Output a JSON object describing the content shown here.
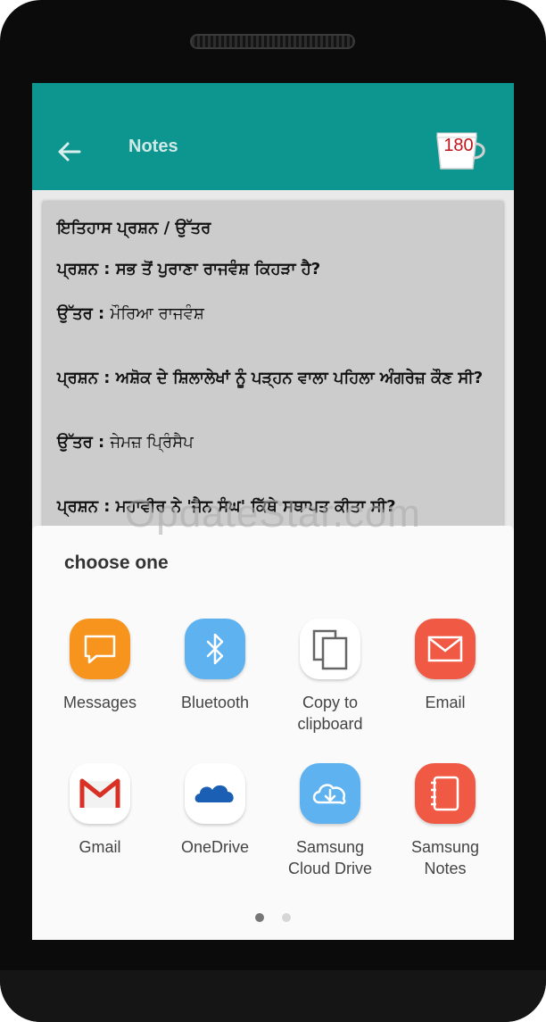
{
  "appbar": {
    "title": "Notes",
    "counter": "180",
    "colors": {
      "bar": "#0d9690",
      "counter": "#c0141c"
    }
  },
  "note": {
    "heading": "ਇਤਿਹਾਸ ਪ੍ਰਸ਼ਨ / ਉੱਤਰ",
    "qa": [
      {
        "q_label": "ਪ੍ਰਸ਼ਨ",
        "q": "ਸਭ ਤੋਂ ਪੁਰਾਣਾ ਰਾਜਵੰਸ਼ ਕਿਹੜਾ ਹੈ?",
        "a_label": "ਉੱਤਰ",
        "a": "ਮੌਰਿਆ ਰਾਜਵੰਸ਼"
      },
      {
        "q_label": "ਪ੍ਰਸ਼ਨ",
        "q": "ਅਸ਼ੋਕ ਦੇ ਸ਼ਿਲਾਲੇਖਾਂ ਨੂੰ ਪੜ੍ਹਨ ਵਾਲਾ ਪਹਿਲਾ ਅੰਗਰੇਜ਼ ਕੌਣ ਸੀ?",
        "a_label": "ਉੱਤਰ",
        "a": "ਜੇਮਜ਼ ਪ੍ਰਿੰਸੈਪ"
      },
      {
        "q_label": "ਪ੍ਰਸ਼ਨ",
        "q": "ਮਹਾਵੀਰ ਨੇ 'ਜੈਨ ਸੰਘ' ਕਿੱਥੇ ਸਥਾਪਤ ਕੀਤਾ ਸੀ?"
      }
    ]
  },
  "watermark": "OpdateStar.com",
  "share_sheet": {
    "title": "choose one",
    "apps": [
      {
        "label": "Messages",
        "icon": "messages-icon",
        "color": "#f7941d"
      },
      {
        "label": "Bluetooth",
        "icon": "bluetooth-icon",
        "color": "#5fb2f0"
      },
      {
        "label": "Copy to\nclipboard",
        "icon": "copy-icon",
        "color": "#ffffff"
      },
      {
        "label": "Email",
        "icon": "email-icon",
        "color": "#f05a45"
      },
      {
        "label": "Gmail",
        "icon": "gmail-icon",
        "color": "#ffffff"
      },
      {
        "label": "OneDrive",
        "icon": "onedrive-icon",
        "color": "#ffffff"
      },
      {
        "label": "Samsung\nCloud Drive",
        "icon": "cloud-drive-icon",
        "color": "#5fb2f0"
      },
      {
        "label": "Samsung\nNotes",
        "icon": "notes-icon",
        "color": "#f05a45"
      }
    ],
    "page_indicator": {
      "pages": 2,
      "current": 1
    }
  }
}
